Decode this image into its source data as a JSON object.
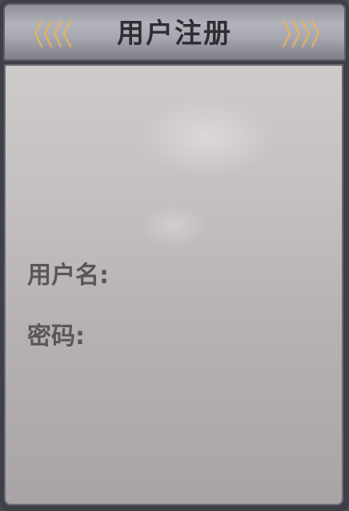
{
  "header": {
    "title": "用户注册"
  },
  "form": {
    "username_label": "用户名:",
    "password_label": "密码:"
  },
  "colors": {
    "accent_gold": "#e6b45a",
    "title_text": "#2f2f33",
    "label_text": "#5a5659"
  },
  "icons": {
    "left_decoration": "chevrons-left-icon",
    "right_decoration": "chevrons-right-icon"
  }
}
